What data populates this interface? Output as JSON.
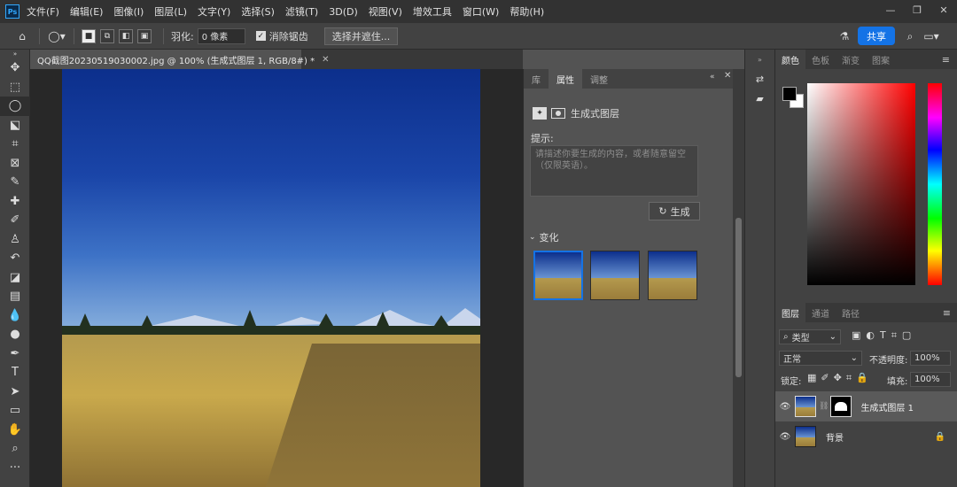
{
  "menu": {
    "logo": "Ps",
    "items": [
      "文件(F)",
      "编辑(E)",
      "图像(I)",
      "图层(L)",
      "文字(Y)",
      "选择(S)",
      "滤镜(T)",
      "3D(D)",
      "视图(V)",
      "增效工具",
      "窗口(W)",
      "帮助(H)"
    ]
  },
  "window": {
    "minimize": "—",
    "restore": "❐",
    "close": "✕"
  },
  "options": {
    "feather_label": "羽化:",
    "feather_value": "0 像素",
    "antialias_label": "消除锯齿",
    "select_subject_label": "选择并遮住...",
    "share_label": "共享"
  },
  "document": {
    "tab_title": "QQ截图20230519030002.jpg @ 100% (生成式图层 1, RGB/8#) *",
    "tab_close": "✕"
  },
  "properties": {
    "tabs": [
      "库",
      "属性",
      "调整"
    ],
    "active_tab": "属性",
    "layer_type": "生成式图层",
    "prompt_label": "提示:",
    "prompt_placeholder": "请描述你要生成的内容，或者随意留空（仅限英语）。",
    "generate_label": "生成",
    "variations_label": "变化"
  },
  "color_panel": {
    "tabs": [
      "颜色",
      "色板",
      "渐变",
      "图案"
    ],
    "active_tab": "颜色",
    "foreground": "#000000",
    "background": "#ffffff"
  },
  "layers_panel": {
    "tabs": [
      "图层",
      "通道",
      "路径"
    ],
    "active_tab": "图层",
    "filter_label": "类型",
    "blend_mode": "正常",
    "opacity_label": "不透明度:",
    "opacity_value": "100%",
    "lock_label": "锁定:",
    "fill_label": "填充:",
    "fill_value": "100%",
    "layers": [
      {
        "name": "生成式图层 1",
        "selected": true
      },
      {
        "name": "背景",
        "selected": false
      }
    ]
  },
  "colors": {
    "accent": "#1473e6",
    "selected_thumb": "#1473e6"
  }
}
